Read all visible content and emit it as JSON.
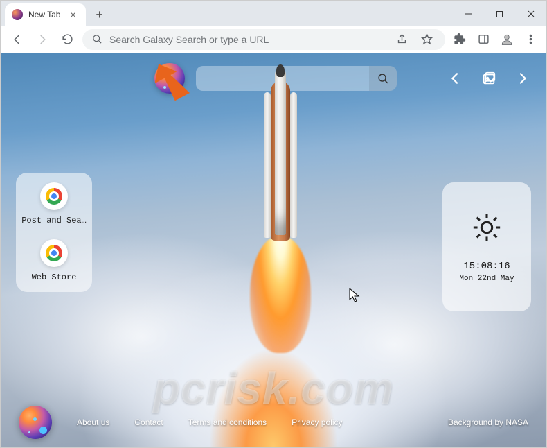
{
  "browser": {
    "tab_title": "New Tab",
    "omnibox_placeholder": "Search Galaxy Search or type a URL"
  },
  "shortcuts": [
    {
      "label": "Post and Sea…"
    },
    {
      "label": "Web Store"
    }
  ],
  "info": {
    "time": "15:08:16",
    "date": "Mon 22nd May"
  },
  "footer": {
    "links": [
      "About us",
      "Contact",
      "Terms and conditions",
      "Privacy policy"
    ],
    "attribution": "Background by NASA"
  },
  "watermark": "pcrisk.com"
}
